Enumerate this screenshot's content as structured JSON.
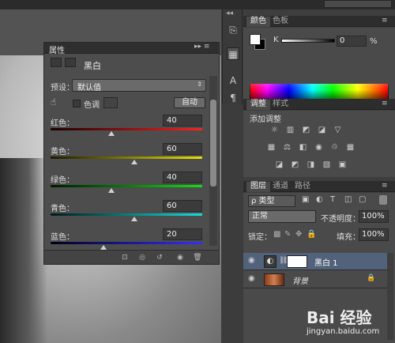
{
  "properties_panel": {
    "title": "属性",
    "menu": "▸▸ ≡",
    "adjustment_label": "黑白",
    "preset_label": "预设：",
    "preset_value": "默认值",
    "tint_label": "色调",
    "auto_label": "自动",
    "sliders": [
      {
        "label": "红色：",
        "value": "40",
        "level": 0.4,
        "gradient": "linear-gradient(90deg,#1a0000,#ff2020)"
      },
      {
        "label": "黄色：",
        "value": "60",
        "level": 0.55,
        "gradient": "linear-gradient(90deg,#1a1a00,#e8e000)"
      },
      {
        "label": "绿色：",
        "value": "40",
        "level": 0.4,
        "gradient": "linear-gradient(90deg,#001a00,#10e010)"
      },
      {
        "label": "青色：",
        "value": "60",
        "level": 0.55,
        "gradient": "linear-gradient(90deg,#001a1a,#10e0e0)"
      },
      {
        "label": "蓝色：",
        "value": "20",
        "level": 0.35,
        "gradient": "linear-gradient(90deg,#00001a,#3030ff)"
      }
    ]
  },
  "color_panel": {
    "tabs": [
      "颜色",
      "色板"
    ],
    "k_label": "K",
    "k_value": "0",
    "k_unit": "%"
  },
  "adjustments_panel": {
    "tabs": [
      "调整",
      "样式"
    ],
    "title": "添加调整",
    "icons_row1": [
      "☼",
      "▥",
      "◩",
      "◪",
      "▽"
    ],
    "icons_row2": [
      "▦",
      "⚖",
      "◧",
      "◉",
      "♲",
      "▦"
    ],
    "icons_row3": [
      "◪",
      "◩",
      "◨",
      "▧",
      "▣"
    ]
  },
  "layers_panel": {
    "tabs": [
      "图层",
      "通道",
      "路径"
    ],
    "kind_label": "ρ 类型",
    "blend_mode": "正常",
    "opacity_label": "不透明度：",
    "opacity_value": "100%",
    "lock_label": "锁定：",
    "fill_label": "填充：",
    "fill_value": "100%",
    "layers": [
      {
        "name": "黑白 1"
      },
      {
        "name": "背景"
      }
    ]
  },
  "watermark": {
    "brand": "Bai 经验",
    "url": "jingyan.baidu.com"
  }
}
